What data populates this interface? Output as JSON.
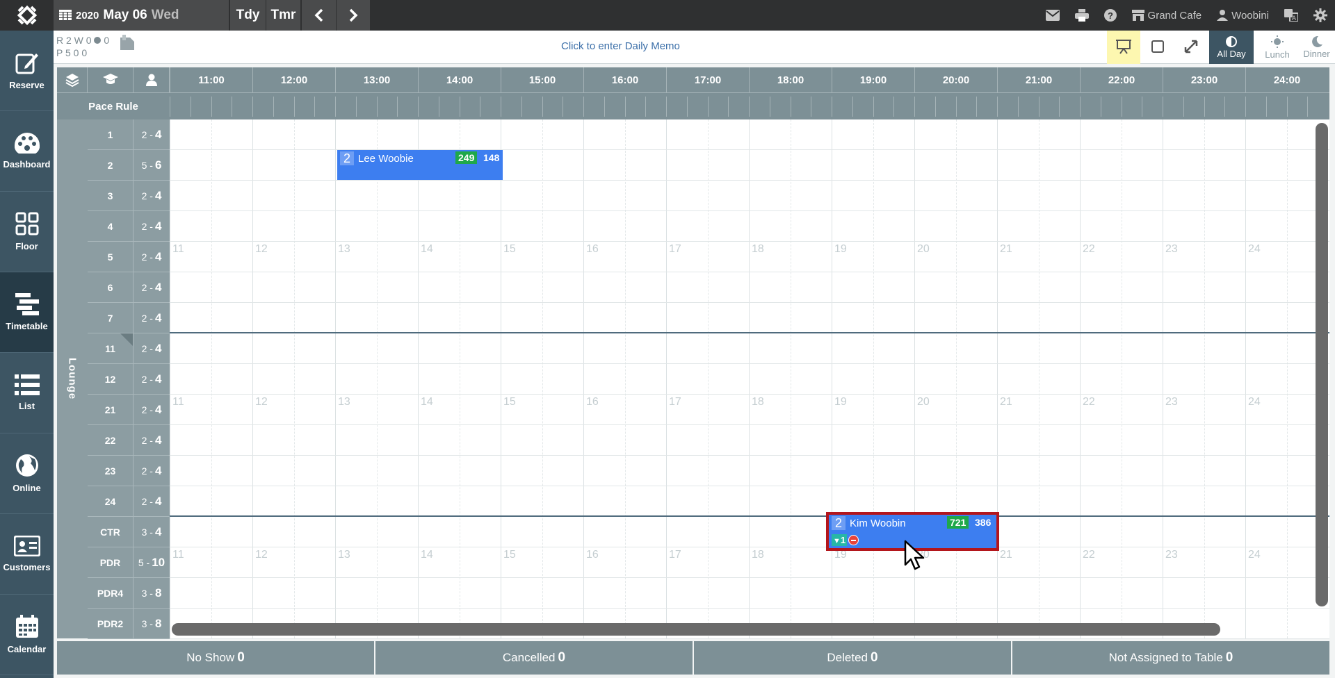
{
  "topbar": {
    "year": "2020",
    "month_day": "May 06",
    "weekday": "Wed",
    "today_label": "Tdy",
    "tomorrow_label": "Tmr",
    "restaurant": "Grand Cafe",
    "user": "Woobini"
  },
  "info": {
    "counts_r": "R 2 W 0 ",
    "counts_r2": " 0",
    "counts_p": "P 5     0     0",
    "memo": "Click to enter Daily Memo"
  },
  "view_buttons": {
    "all_day": "All Day",
    "lunch": "Lunch",
    "dinner": "Dinner"
  },
  "sidebar": {
    "items": [
      {
        "label": "Reserve",
        "icon": "edit-icon"
      },
      {
        "label": "Dashboard",
        "icon": "palette-icon"
      },
      {
        "label": "Floor",
        "icon": "grid-icon"
      },
      {
        "label": "Timetable",
        "icon": "timetable-icon"
      },
      {
        "label": "List",
        "icon": "list-icon"
      },
      {
        "label": "Online",
        "icon": "globe-icon"
      },
      {
        "label": "Customers",
        "icon": "id-card-icon"
      },
      {
        "label": "Calendar",
        "icon": "calendar-icon"
      }
    ]
  },
  "timetable": {
    "pace_rule_label": "Pace Rule",
    "section_label": "Lounge",
    "hours": [
      "11:00",
      "12:00",
      "13:00",
      "14:00",
      "15:00",
      "16:00",
      "17:00",
      "18:00",
      "19:00",
      "20:00",
      "21:00",
      "22:00",
      "23:00",
      "24:00"
    ],
    "row_hours": [
      "11",
      "12",
      "13",
      "14",
      "15",
      "16",
      "17",
      "18",
      "19",
      "20",
      "21",
      "22",
      "23",
      "24"
    ],
    "tables": [
      {
        "name": "1",
        "min": "2 -",
        "max": "4"
      },
      {
        "name": "2",
        "min": "5 -",
        "max": "6"
      },
      {
        "name": "3",
        "min": "2 -",
        "max": "4"
      },
      {
        "name": "4",
        "min": "2 -",
        "max": "4"
      },
      {
        "name": "5",
        "min": "2 -",
        "max": "4"
      },
      {
        "name": "6",
        "min": "2 -",
        "max": "4"
      },
      {
        "name": "7",
        "min": "2 -",
        "max": "4"
      },
      {
        "name": "11",
        "min": "2 -",
        "max": "4"
      },
      {
        "name": "12",
        "min": "2 -",
        "max": "4"
      },
      {
        "name": "21",
        "min": "2 -",
        "max": "4"
      },
      {
        "name": "22",
        "min": "2 -",
        "max": "4"
      },
      {
        "name": "23",
        "min": "2 -",
        "max": "4"
      },
      {
        "name": "24",
        "min": "2 -",
        "max": "4"
      },
      {
        "name": "CTR",
        "min": "3 -",
        "max": "4"
      },
      {
        "name": "PDR",
        "min": "5 -",
        "max": "10"
      },
      {
        "name": "PDR4",
        "min": "3 -",
        "max": "8"
      },
      {
        "name": "PDR2",
        "min": "3 -",
        "max": "8"
      }
    ],
    "reservations": [
      {
        "pax": "2",
        "name": "Lee Woobie",
        "num_a": "249",
        "num_b": "148",
        "table": "2",
        "start": "13:00",
        "end": "15:00"
      },
      {
        "pax": "2",
        "name": "Kim Woobin",
        "num_a": "721",
        "num_b": "386",
        "table": "CTR",
        "start": "19:00",
        "end": "21:00",
        "badge": "1"
      }
    ]
  },
  "bottom": {
    "no_show": "No Show",
    "no_show_count": "0",
    "cancelled": "Cancelled",
    "cancelled_count": "0",
    "deleted": "Deleted",
    "deleted_count": "0",
    "not_assigned": "Not Assigned to Table",
    "not_assigned_count": "0"
  }
}
